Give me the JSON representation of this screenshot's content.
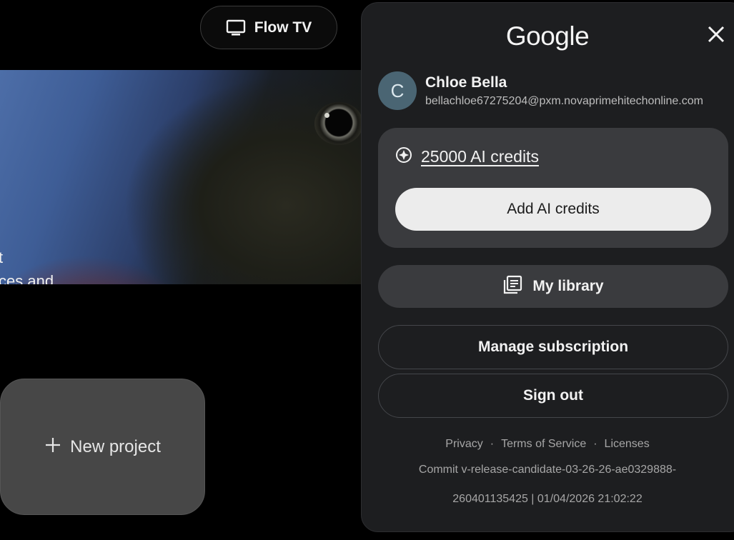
{
  "header": {
    "flow_tv_label": "Flow TV",
    "flow_tv_icon": "tv-icon"
  },
  "hero": {
    "caption_line1": "t",
    "caption_line2": "ces and"
  },
  "projects": {
    "new_project_label": "New project",
    "new_project_icon": "plus-icon"
  },
  "account_panel": {
    "brand": "Google",
    "close_icon": "close-icon",
    "user": {
      "avatar_initial": "C",
      "avatar_color": "#4a6573",
      "name": "Chloe Bella",
      "email": "bellachloe67275204@pxm.novaprimehitechonline.com"
    },
    "credits": {
      "icon": "ai-credits-icon",
      "label": "25000 AI credits",
      "add_button_label": "Add AI credits"
    },
    "library": {
      "icon": "library-icon",
      "label": "My library"
    },
    "manage_subscription_label": "Manage subscription",
    "sign_out_label": "Sign out",
    "footer": {
      "privacy": "Privacy",
      "separator": "·",
      "terms": "Terms of Service",
      "licenses": "Licenses",
      "commit_line1": "Commit v-release-candidate-03-26-26-ae0329888-",
      "commit_line2": "260401135425 | 01/04/2026 21:02:22"
    }
  },
  "colors": {
    "background": "#000000",
    "panel": "#1d1e20",
    "card": "#3a3b3e",
    "primary_button": "#ececec",
    "new_project_card": "#474747"
  }
}
